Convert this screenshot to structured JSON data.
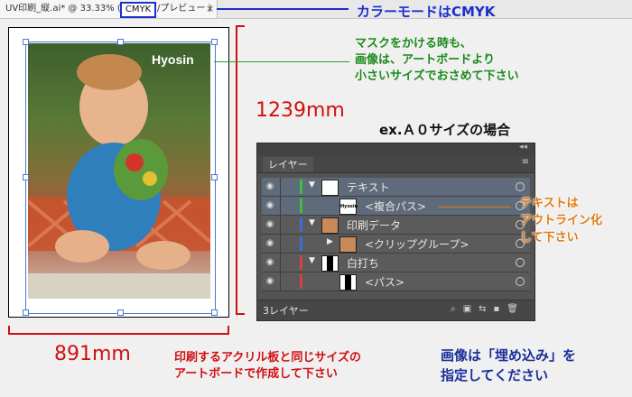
{
  "tab": {
    "title": "UV印刷_縦.ai* @ 33.33% (",
    "mode": "CMYK",
    "preview": "/プレビュー )",
    "close": "×"
  },
  "notes": {
    "color_mode": "カラーモードはCMYK",
    "mask_line1": "マスクをかける時も、",
    "mask_line2": "画像は、アートボードより",
    "mask_line3": "小さいサイズでおさめて下さい",
    "size_example": "ex.Ａ０サイズの場合",
    "outline_line1": "テキストは",
    "outline_line2": "アウトライン化",
    "outline_line3": "して下さい",
    "artboard_line1": "印刷するアクリル板と同じサイズの",
    "artboard_line2": "アートボードで作成して下さい",
    "embed_line1": "画像は「埋め込み」を",
    "embed_line2": "指定してください"
  },
  "dimensions": {
    "height": "1239mm",
    "width": "891mm"
  },
  "artwork": {
    "overlay_text": "Hyosin"
  },
  "layers_panel": {
    "tab_label": "レイヤー",
    "menu_icon": "≡",
    "collapse_icon": "◂◂",
    "layers": [
      {
        "name": "テキスト",
        "color": "#3fbf3f",
        "indent": 0,
        "thumb": "blank",
        "selected": true
      },
      {
        "name": "<複合パス>",
        "color": "#3fbf3f",
        "indent": 1,
        "thumb": "Hyosin",
        "selected": true
      },
      {
        "name": "印刷データ",
        "color": "#3b6fd6",
        "indent": 0,
        "thumb": "photo"
      },
      {
        "name": "<クリップグループ>",
        "color": "#3b6fd6",
        "indent": 1,
        "thumb": "photo"
      },
      {
        "name": "白打ち",
        "color": "#d64040",
        "indent": 0,
        "thumb": "black"
      },
      {
        "name": "<パス>",
        "color": "#d64040",
        "indent": 1,
        "thumb": "black"
      }
    ],
    "layer_count": "3レイヤー",
    "eye_icon": "◉"
  }
}
